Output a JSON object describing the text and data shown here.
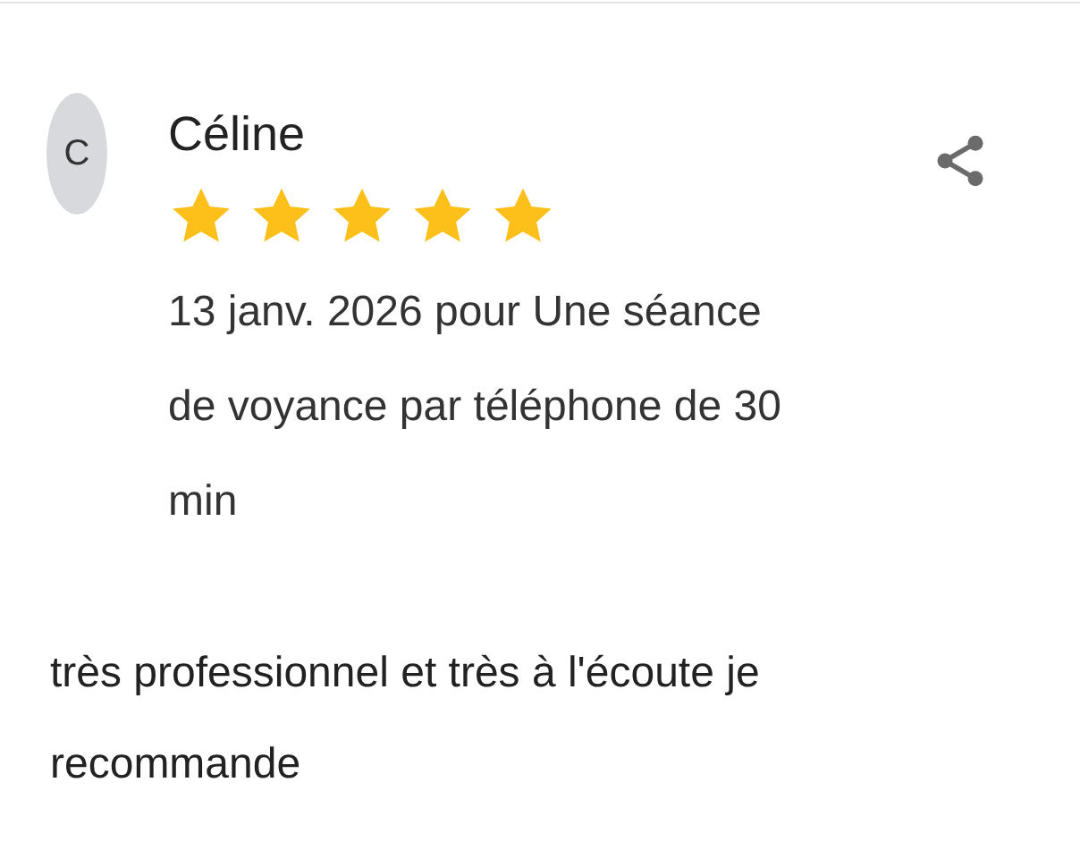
{
  "review": {
    "initial": "C",
    "name": "Céline",
    "stars": 5,
    "details": "13 janv. 2026 pour Une séance de voyance par téléphone de 30 min",
    "comment": "très professionnel et très à l'écoute je recommande"
  }
}
